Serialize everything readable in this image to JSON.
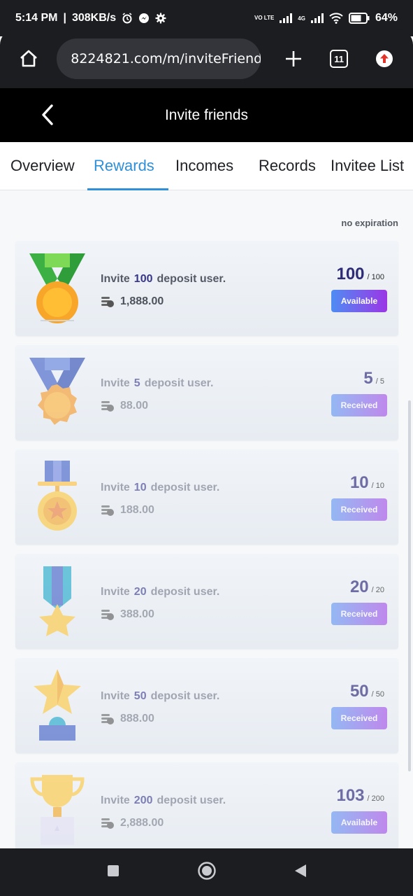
{
  "status_bar": {
    "time": "5:14 PM",
    "speed": "308KB/s",
    "network_label": "VO LTE",
    "signal_label": "4G",
    "battery": "64%"
  },
  "browser": {
    "url": "8224821.com/m/inviteFriend",
    "tab_count": "11"
  },
  "header": {
    "title": "Invite friends"
  },
  "tabs": [
    "Overview",
    "Rewards",
    "Incomes",
    "Records",
    "Invitee List"
  ],
  "active_tab": "Rewards",
  "expiry": "no expiration",
  "rewards": [
    {
      "prefix": "Invite",
      "count": "100",
      "suffix": "deposit user.",
      "amount": "1,888.00",
      "progress": "100",
      "target": "/ 100",
      "status": "Available",
      "medal": "green-ribbon-gold-medal-icon"
    },
    {
      "prefix": "Invite",
      "count": "5",
      "suffix": "deposit user.",
      "amount": "88.00",
      "progress": "5",
      "target": "/ 5",
      "status": "Received",
      "medal": "blue-ribbon-medal-icon"
    },
    {
      "prefix": "Invite",
      "count": "10",
      "suffix": "deposit user.",
      "amount": "188.00",
      "progress": "10",
      "target": "/ 10",
      "status": "Received",
      "medal": "gold-star-medal-icon"
    },
    {
      "prefix": "Invite",
      "count": "20",
      "suffix": "deposit user.",
      "amount": "388.00",
      "progress": "20",
      "target": "/ 20",
      "status": "Received",
      "medal": "star-ribbon-medal-icon"
    },
    {
      "prefix": "Invite",
      "count": "50",
      "suffix": "deposit user.",
      "amount": "888.00",
      "progress": "50",
      "target": "/ 50",
      "status": "Received",
      "medal": "star-trophy-icon"
    },
    {
      "prefix": "Invite",
      "count": "200",
      "suffix": "deposit user.",
      "amount": "2,888.00",
      "progress": "103",
      "target": "/ 200",
      "status": "Available",
      "medal": "gold-cup-trophy-icon"
    }
  ],
  "colors": {
    "accent": "#2f8fd8",
    "button_gradient_start": "#4f8cf3",
    "button_gradient_end": "#9b36e6",
    "count_color": "#2e2b78"
  }
}
